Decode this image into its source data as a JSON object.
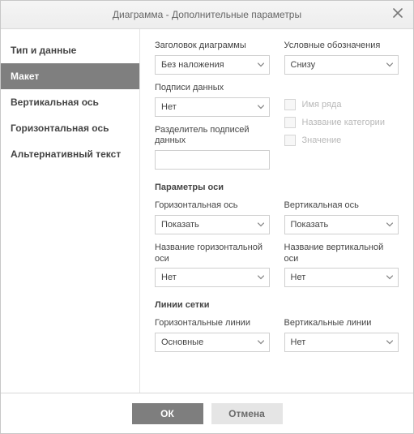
{
  "title": "Диаграмма - Дополнительные параметры",
  "sidebar": {
    "items": [
      {
        "label": "Тип и данные"
      },
      {
        "label": "Макет"
      },
      {
        "label": "Вертикальная ось"
      },
      {
        "label": "Горизонтальная ось"
      },
      {
        "label": "Альтернативный текст"
      }
    ],
    "activeIndex": 1
  },
  "fields": {
    "chartTitle": {
      "label": "Заголовок диаграммы",
      "value": "Без наложения"
    },
    "legend": {
      "label": "Условные обозначения",
      "value": "Снизу"
    },
    "dataLabels": {
      "label": "Подписи данных",
      "value": "Нет"
    },
    "separator": {
      "label": "Разделитель подписей данных",
      "value": ""
    }
  },
  "checks": {
    "seriesName": {
      "label": "Имя ряда"
    },
    "categoryName": {
      "label": "Название категории"
    },
    "value": {
      "label": "Значение"
    }
  },
  "axisSection": {
    "title": "Параметры оси",
    "horizAxis": {
      "label": "Горизонтальная ось",
      "value": "Показать"
    },
    "vertAxis": {
      "label": "Вертикальная ось",
      "value": "Показать"
    },
    "horizAxisName": {
      "label": "Название горизонтальной оси",
      "value": "Нет"
    },
    "vertAxisName": {
      "label": "Название вертикальной оси",
      "value": "Нет"
    }
  },
  "gridSection": {
    "title": "Линии сетки",
    "horizLines": {
      "label": "Горизонтальные линии",
      "value": "Основные"
    },
    "vertLines": {
      "label": "Вертикальные линии",
      "value": "Нет"
    }
  },
  "buttons": {
    "ok": "ОК",
    "cancel": "Отмена"
  }
}
